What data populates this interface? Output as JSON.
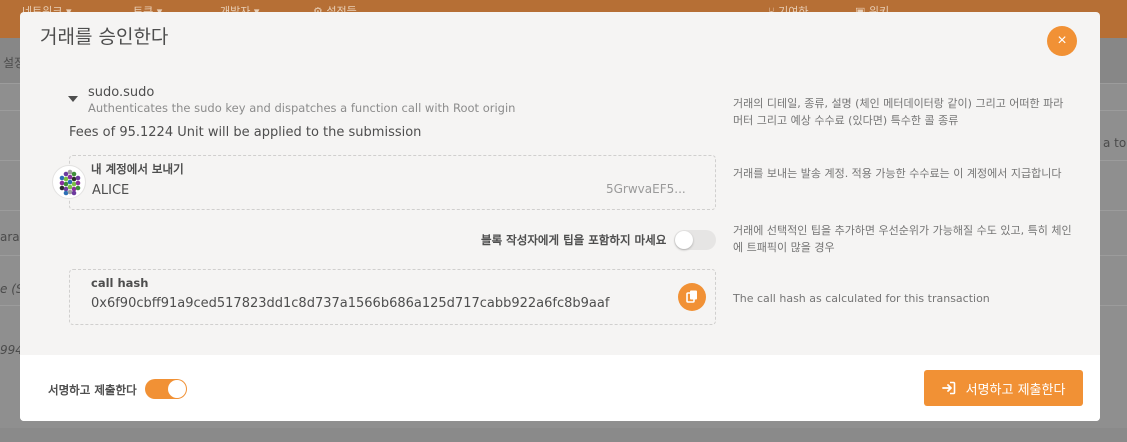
{
  "background": {
    "nav_items": [
      "네트워크 ▾",
      "토큰 ▾",
      "개발자 ▾",
      "⚙ 설정들"
    ],
    "nav_right": [
      "⑂ 기여하",
      "▣ 위키"
    ],
    "side_texts": [
      "설정",
      "a to",
      "aras",
      "e (S",
      "994"
    ]
  },
  "modal": {
    "title": "거래를 승인한다",
    "close_symbol": "×",
    "call": {
      "name": "sudo.sudo",
      "description": "Authenticates the sudo key and dispatches a function call with Root origin",
      "fees": "Fees of 95.1224 Unit will be applied to the submission",
      "info": "거래의 디테일, 종류, 설명 (체인 메터데이터랑 같이) 그리고 어떠한 파라머터 그리고 예상 수수료 (있다면) 특수한 콜 종류"
    },
    "account": {
      "label": "내 계정에서 보내기",
      "name": "ALICE",
      "address": "5GrwvaEF5...",
      "info": "거래를 보내는 발송 계정. 적용 가능한 수수료는 이 계정에서 지급합니다"
    },
    "tip": {
      "label": "블록 작성자에게 팁을 포함하지 마세요",
      "info": "거래에 선택적인 팁을 추가하면 우선순위가 가능해질 수도 있고, 특히 체인에 트패픽이 많을 경우"
    },
    "call_hash": {
      "label": "call hash",
      "value": "0x6f90cbff91a9ced517823dd1c8d737a1566b686a125d717cabb922a6fc8b9aaf",
      "info": "The call hash as calculated for this transaction"
    },
    "footer": {
      "toggle_label": "서명하고 제출한다",
      "submit_label": "서명하고 제출한다"
    }
  },
  "colors": {
    "accent": "#f19135",
    "modal_bg": "#f5f4f3"
  }
}
